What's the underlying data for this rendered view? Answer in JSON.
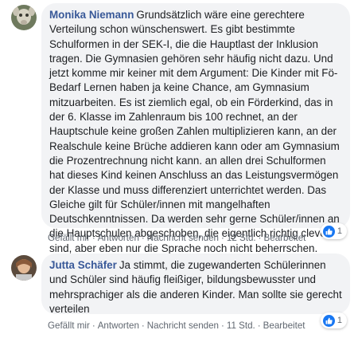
{
  "comments": [
    {
      "author": "Monika Niemann",
      "text": "Grundsätzlich wäre eine gerechtere Verteilung schon wünschenswert. Es gibt bestimmte Schulformen in der SEK-I, die die Hauptlast der Inklusion tragen. Die Gymnasien gehören sehr häufig nicht dazu. Und jetzt komme mir keiner mit dem Argument: Die Kinder mit Fö-Bedarf Lernen haben ja keine Chance, am Gymnasium mitzuarbeiten. Es ist ziemlich egal, ob ein Förderkind, das in der 6. Klasse im Zahlenraum bis 100 rechnet, an der Hauptschule keine großen Zahlen multiplizieren kann, an der Realschule keine Brüche addieren kann oder am Gymnasium die Prozentrechnung nicht kann. an allen drei Schulformen hat dieses Kind keinen Anschluss an das Leistungsvermögen der Klasse und muss differenziert unterrichtet werden. Das Gleiche gilt für Schüler/innen mit mangelhaften Deutschkenntnissen. Da werden sehr gerne Schüler/innen an die Hauptschulen abgeschoben, die eigentlich richtig clever sind, aber eben nur die Sprache noch nicht beherrschen.",
      "actions": {
        "like": "Gefällt mir",
        "reply": "Antworten",
        "message": "Nachricht senden",
        "time": "12 Std.",
        "edited": "Bearbeitet"
      },
      "reaction_count": "1",
      "avatar_color": "#8a8f7a"
    },
    {
      "author": "Jutta Schäfer",
      "text": "Ja stimmt, die zugewanderten Schülerinnen und Schüler sind häufig fleißiger, bildungsbewusster und mehrsprachiger als die anderen Kinder. Man sollte sie gerecht verteilen",
      "actions": {
        "like": "Gefällt mir",
        "reply": "Antworten",
        "message": "Nachricht senden",
        "time": "11 Std.",
        "edited": "Bearbeitet"
      },
      "reaction_count": "1",
      "avatar_color": "#a97a5a"
    }
  ],
  "colors": {
    "bubble": "#f2f3f5",
    "author": "#385898",
    "meta": "#606770",
    "like": "#1877f2"
  },
  "icons": [
    "avatar",
    "like-icon"
  ]
}
